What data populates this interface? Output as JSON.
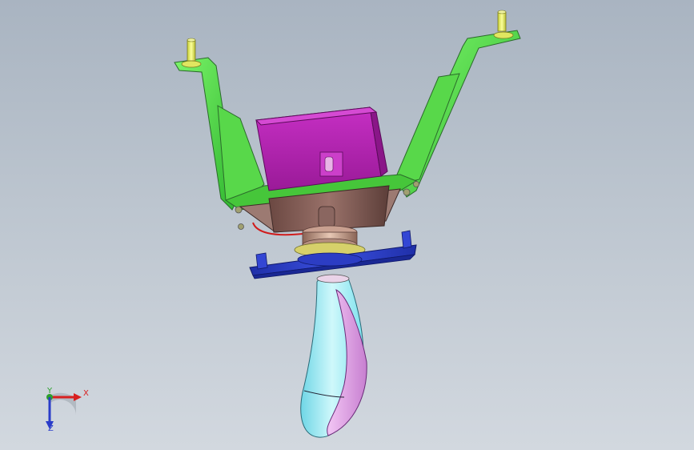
{
  "viewport": {
    "background_top": "#a9b4c1",
    "background_bottom": "#d2d8df"
  },
  "model": {
    "parts": [
      {
        "name": "mounting-bracket",
        "color": "#4fe04f"
      },
      {
        "name": "actuator-box",
        "color": "#b51fb3"
      },
      {
        "name": "motor-housing",
        "color": "#7e5a52"
      },
      {
        "name": "coupling-ring",
        "color": "#b08a75"
      },
      {
        "name": "base-plate",
        "color": "#2a3cc9"
      },
      {
        "name": "shift-knob",
        "colors": [
          "#7fe6ef",
          "#e5a6ea"
        ]
      },
      {
        "name": "mounting-studs",
        "color": "#e6ec52"
      },
      {
        "name": "wire",
        "color": "#d01c1c"
      }
    ]
  },
  "triad": {
    "x_label": "X",
    "y_label": "Y",
    "z_label": "Z",
    "x_color": "#d82020",
    "y_color": "#2ca02c",
    "z_color": "#2a3cc9"
  }
}
